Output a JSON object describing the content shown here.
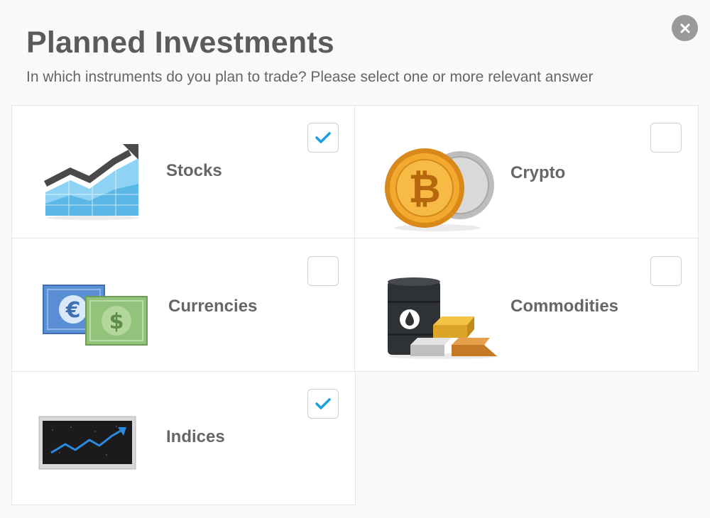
{
  "dialog": {
    "title": "Planned Investments",
    "subtitle": "In which instruments do you plan to trade? Please select one or more relevant answer",
    "close_icon": "close-icon"
  },
  "options": [
    {
      "id": "stocks",
      "label": "Stocks",
      "checked": true,
      "icon": "rising-chart-icon"
    },
    {
      "id": "crypto",
      "label": "Crypto",
      "checked": false,
      "icon": "bitcoin-coin-icon"
    },
    {
      "id": "currencies",
      "label": "Currencies",
      "checked": false,
      "icon": "banknotes-icon"
    },
    {
      "id": "commodities",
      "label": "Commodities",
      "checked": false,
      "icon": "oil-barrel-gold-bars-icon"
    },
    {
      "id": "indices",
      "label": "Indices",
      "checked": true,
      "icon": "index-ticker-icon"
    }
  ],
  "colors": {
    "accent": "#1a9fe0",
    "title": "#5b5b5b",
    "text": "#666666"
  }
}
